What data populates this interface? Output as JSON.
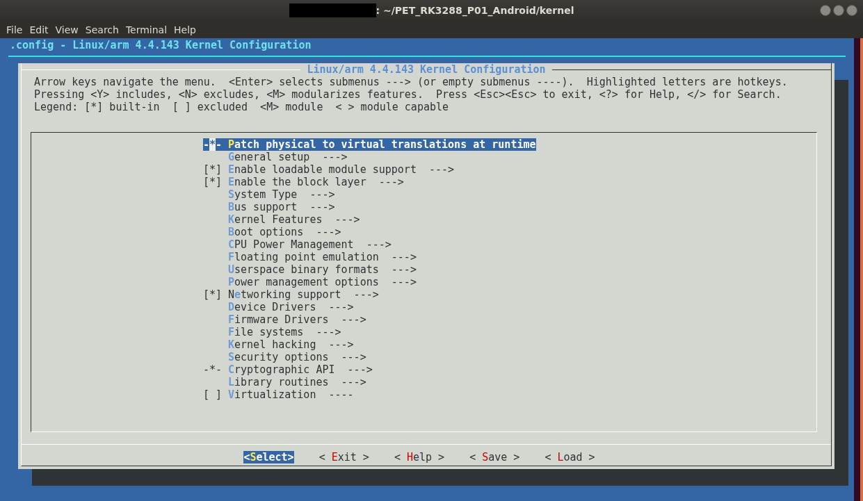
{
  "window": {
    "title": ": ~/PET_RK3288_P01_Android/kernel"
  },
  "menubar": [
    "File",
    "Edit",
    "View",
    "Search",
    "Terminal",
    "Help"
  ],
  "terminal": {
    "header": ".config - Linux/arm 4.4.143 Kernel Configuration"
  },
  "dialog": {
    "title": "Linux/arm 4.4.143 Kernel Configuration",
    "help_lines": [
      "Arrow keys navigate the menu.  <Enter> selects submenus ---> (or empty submenus ----).  Highlighted letters are hotkeys.",
      "Pressing <Y> includes, <N> excludes, <M> modularizes features.  Press <Esc><Esc> to exit, <?> for Help, </> for Search.",
      "Legend: [*] built-in  [ ] excluded  <M> module  < > module capable"
    ],
    "items": [
      {
        "prefix": "-*-",
        "hotkey": "P",
        "label_end": "atch physical to virtual translations at runtime",
        "selected": true
      },
      {
        "hotkey": "G",
        "label_end": "eneral setup",
        "arrow": "--->",
        "selected": false
      },
      {
        "prefix": "[*]",
        "hotkey": "E",
        "label_end": "nable loadable module support",
        "arrow": "--->",
        "selected": false
      },
      {
        "prefix": "[*]",
        "hotkey": "E",
        "label_end": "nable the block layer",
        "arrow": "--->",
        "selected": false
      },
      {
        "hotkey": "S",
        "label_end": "ystem Type",
        "arrow": "--->",
        "selected": false
      },
      {
        "hotkey": "B",
        "label_end": "us support",
        "arrow": "--->",
        "selected": false
      },
      {
        "hotkey": "K",
        "label_end": "ernel Features",
        "arrow": "--->",
        "selected": false
      },
      {
        "hotkey": "B",
        "label_end": "oot options",
        "arrow": "--->",
        "selected": false
      },
      {
        "hotkey": "C",
        "label_end": "PU Power Management",
        "arrow": "--->",
        "selected": false
      },
      {
        "hotkey": "F",
        "label_end": "loating point emulation",
        "arrow": "--->",
        "selected": false
      },
      {
        "hotkey": "U",
        "label_end": "serspace binary formats",
        "arrow": "--->",
        "selected": false
      },
      {
        "hotkey": "P",
        "label_end": "ower management options",
        "arrow": "--->",
        "selected": false
      },
      {
        "prefix": "[*]",
        "label_start": "N",
        "hotkey": "e",
        "label_end": "tworking support",
        "arrow": "--->",
        "selected": false
      },
      {
        "hotkey": "D",
        "label_end": "evice Drivers",
        "arrow": "--->",
        "selected": false
      },
      {
        "hotkey": "F",
        "label_end": "irmware Drivers",
        "arrow": "--->",
        "selected": false
      },
      {
        "hotkey": "F",
        "label_end": "ile systems",
        "arrow": "--->",
        "selected": false
      },
      {
        "hotkey": "K",
        "label_end": "ernel hacking",
        "arrow": "--->",
        "selected": false
      },
      {
        "hotkey": "S",
        "label_end": "ecurity options",
        "arrow": "--->",
        "selected": false
      },
      {
        "prefix": "-*-",
        "hotkey": "C",
        "label_end": "ryptographic API",
        "arrow": "--->",
        "selected": false
      },
      {
        "hotkey": "L",
        "label_end": "ibrary routines",
        "arrow": "--->",
        "selected": false
      },
      {
        "prefix": "[ ]",
        "hotkey": "V",
        "label_end": "irtualization",
        "arrow": "----",
        "selected": false
      }
    ],
    "buttons": [
      {
        "label_start": "<",
        "hotkey": "S",
        "label_end": "elect>",
        "selected": true
      },
      {
        "label_start": "< ",
        "hotkey": "E",
        "label_end": "xit >",
        "selected": false
      },
      {
        "label_start": "< ",
        "hotkey": "H",
        "label_end": "elp >",
        "selected": false
      },
      {
        "label_start": "< ",
        "hotkey": "S",
        "label_end": "ave >",
        "selected": false
      },
      {
        "label_start": "< ",
        "hotkey": "L",
        "label_end": "oad >",
        "selected": false
      }
    ]
  }
}
